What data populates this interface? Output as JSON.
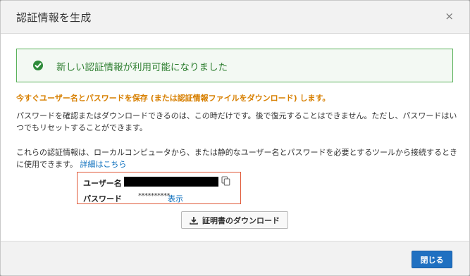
{
  "dialog": {
    "title": "認証情報を生成",
    "close_icon": "×"
  },
  "alert": {
    "message": "新しい認証情報が利用可能になりました",
    "icon": "check-circle-icon",
    "color": "#2f7f31"
  },
  "warning": {
    "text": "今すぐユーザー名とパスワードを保存 (または認証情報ファイルをダウンロード) します。",
    "color": "#d77f00"
  },
  "info1": "パスワードを確認またはダウンロードできるのは、この時だけです。後で復元することはできません。ただし、パスワードはいつでもリセットすることができます。",
  "info2": {
    "text": "これらの認証情報は、ローカルコンピュータから、または静的なユーザー名とパスワードを必要とするツールから接続するときに使用できます。",
    "link": "詳細はこちら"
  },
  "credentials": {
    "username_label": "ユーザー名",
    "password_label": "パスワード",
    "password_masked": "**********",
    "show_link": "表示"
  },
  "download_button": "証明書のダウンロード",
  "footer": {
    "close_button": "閉じる",
    "primary_color": "#1f70c1"
  }
}
